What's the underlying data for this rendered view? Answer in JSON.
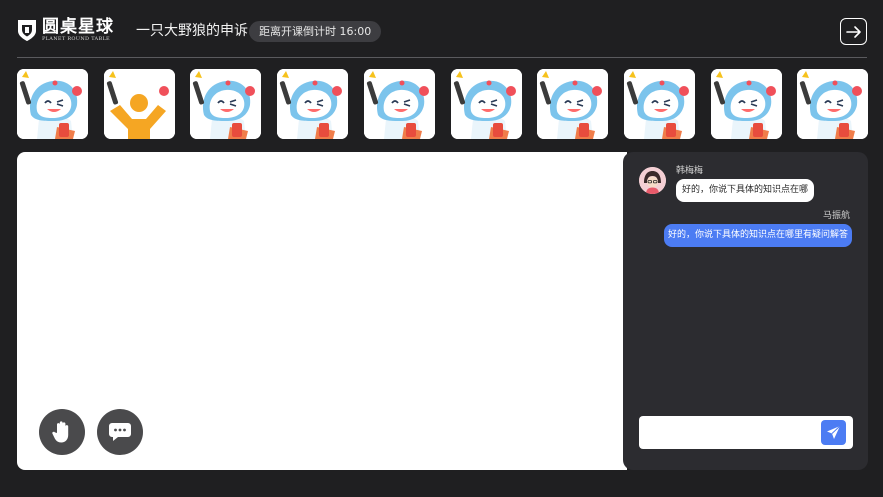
{
  "header": {
    "logo_cn": "圆桌星球",
    "logo_en": "PLANET ROUND TABLE",
    "title": "一只大野狼的申诉",
    "countdown": "距离开课倒计时 16:00"
  },
  "participants": [
    {
      "avatar": "robot-mascot-icon"
    },
    {
      "avatar": "person-silhouette-icon"
    },
    {
      "avatar": "robot-mascot-icon"
    },
    {
      "avatar": "robot-mascot-icon"
    },
    {
      "avatar": "robot-mascot-icon"
    },
    {
      "avatar": "robot-mascot-icon"
    },
    {
      "avatar": "robot-mascot-icon"
    },
    {
      "avatar": "robot-mascot-icon"
    },
    {
      "avatar": "robot-mascot-icon"
    },
    {
      "avatar": "robot-mascot-icon"
    }
  ],
  "toolbar": {
    "raise_hand_icon": "hand-icon",
    "chat_icon": "chat-bubble-icon"
  },
  "chat": {
    "messages": [
      {
        "sender": "韩梅梅",
        "text": "好的，你说下具体的知识点在哪",
        "side": "left"
      },
      {
        "sender": "马振航",
        "text": "好的，你说下具体的知识点在哪里有疑问解答",
        "side": "right"
      }
    ],
    "input_value": "",
    "input_placeholder": "",
    "send_icon": "send-icon"
  },
  "colors": {
    "background": "#1f1f21",
    "panel": "#2c2c30",
    "accent": "#4c7cf3",
    "person_orange": "#f5a623"
  }
}
